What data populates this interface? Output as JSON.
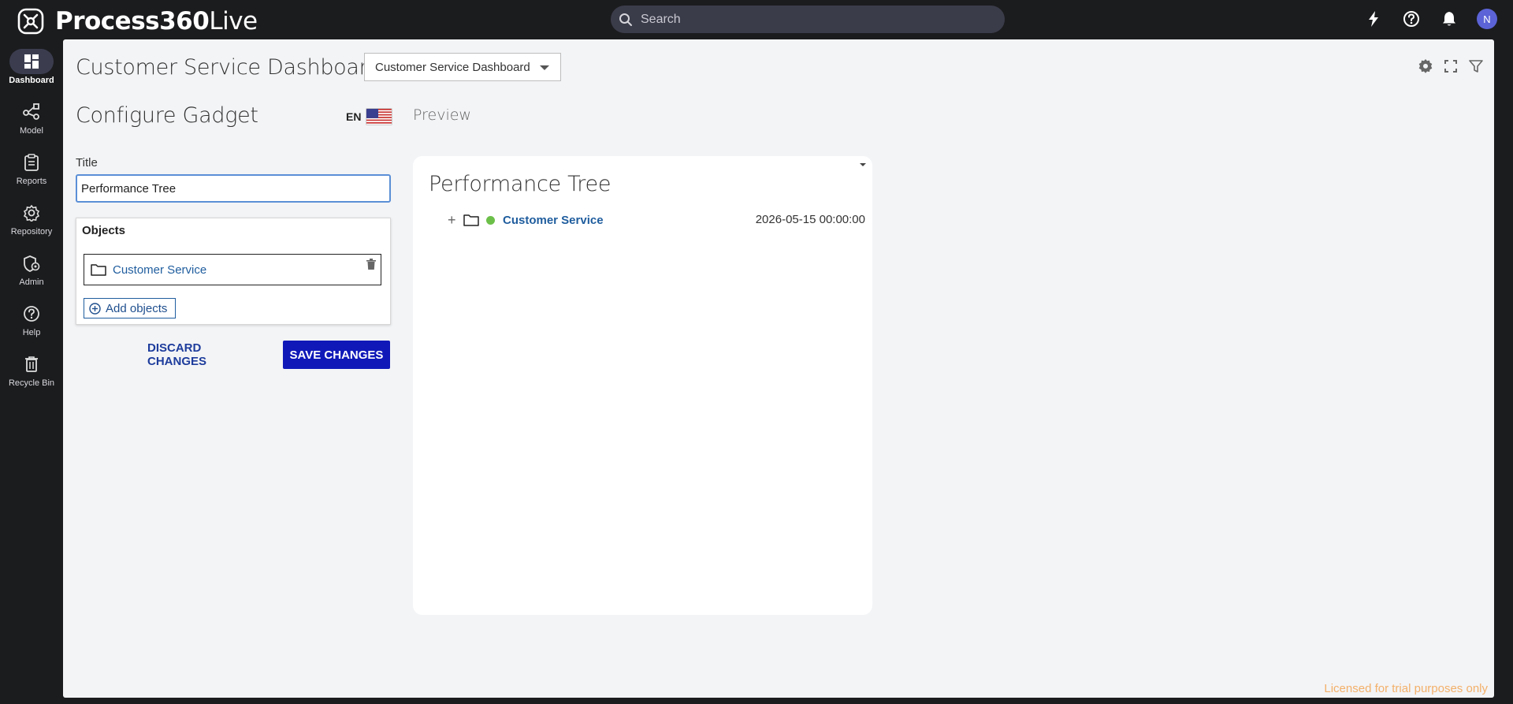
{
  "app": {
    "brand_bold": "Process360",
    "brand_light": "Live",
    "search_placeholder": "Search",
    "avatar_initial": "N"
  },
  "sidebar": {
    "items": [
      {
        "label": "Dashboard",
        "icon": "dashboard-icon",
        "active": true
      },
      {
        "label": "Model",
        "icon": "model-icon",
        "active": false
      },
      {
        "label": "Reports",
        "icon": "reports-icon",
        "active": false
      },
      {
        "label": "Repository",
        "icon": "repository-icon",
        "active": false
      },
      {
        "label": "Admin",
        "icon": "admin-icon",
        "active": false
      },
      {
        "label": "Help",
        "icon": "help-icon",
        "active": false
      },
      {
        "label": "Recycle Bin",
        "icon": "recycle-bin-icon",
        "active": false
      }
    ]
  },
  "header": {
    "dashboard_title": "Customer Service Dashboard",
    "dashboard_select_value": "Customer Service Dashboard"
  },
  "config": {
    "title": "Configure Gadget",
    "language_code": "EN",
    "title_label": "Title",
    "title_value": "Performance Tree",
    "objects_header": "Objects",
    "objects": [
      {
        "name": "Customer Service"
      }
    ],
    "add_objects_label": "Add objects",
    "discard_label": "DISCARD CHANGES",
    "save_label": "SAVE CHANGES"
  },
  "preview": {
    "label": "Preview",
    "card_title": "Performance Tree",
    "tree": [
      {
        "name": "Customer Service",
        "timestamp": "2026-05-15 00:00:00",
        "status_color": "#6cc04a"
      }
    ]
  },
  "footer": {
    "license_text": "Licensed for trial purposes only"
  },
  "colors": {
    "accent_blue": "#1019b8",
    "link_blue": "#1f5d9e",
    "status_green": "#6cc04a",
    "license_orange": "#f3b06a"
  }
}
